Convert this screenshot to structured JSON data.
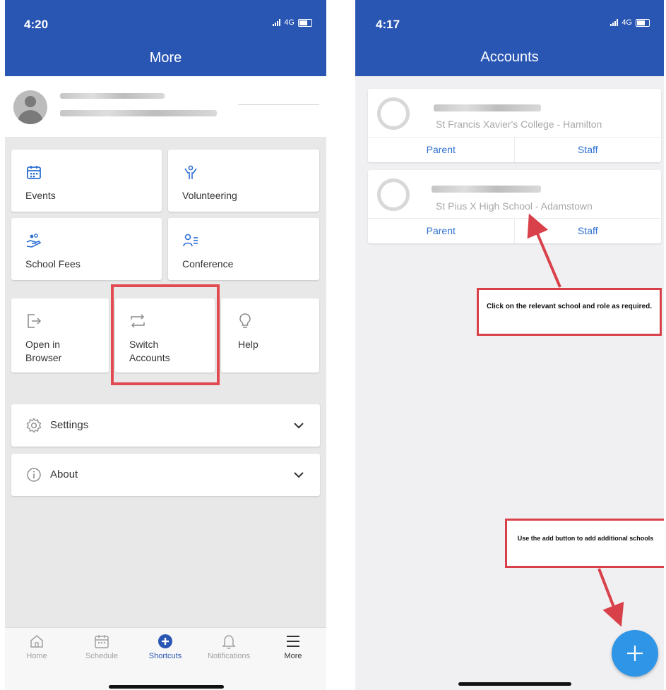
{
  "left_screen": {
    "status_time": "4:20",
    "network": "4G",
    "nav_title": "More",
    "tiles": [
      {
        "label": "Events",
        "icon": "calendar-icon"
      },
      {
        "label": "Volunteering",
        "icon": "volunteer-hands-icon"
      },
      {
        "label": "School Fees",
        "icon": "payment-hand-icon"
      },
      {
        "label": "Conference",
        "icon": "people-list-icon"
      },
      {
        "label": "Open in\nBrowser",
        "icon": "open-external-icon"
      },
      {
        "label": "Switch\nAccounts",
        "icon": "switch-arrows-icon"
      },
      {
        "label": "Help",
        "icon": "lightbulb-icon"
      }
    ],
    "settings_label": "Settings",
    "about_label": "About",
    "tabbar": [
      {
        "label": "Home",
        "icon": "home-icon"
      },
      {
        "label": "Schedule",
        "icon": "schedule-icon"
      },
      {
        "label": "Shortcuts",
        "icon": "shortcuts-plus-icon"
      },
      {
        "label": "Notifications",
        "icon": "bell-icon"
      },
      {
        "label": "More",
        "icon": "hamburger-menu-icon"
      }
    ]
  },
  "right_screen": {
    "status_time": "4:17",
    "network": "4G",
    "nav_title": "Accounts",
    "accounts": [
      {
        "school": "St Francis Xavier's College - Hamilton",
        "role_left": "Parent",
        "role_right": "Staff"
      },
      {
        "school": "St Pius X High School - Adamstown",
        "role_left": "Parent",
        "role_right": "Staff"
      }
    ],
    "callout_roles": "Click on the relevant school and role as required.",
    "callout_add": "Use the add button to add additional schools"
  },
  "colors": {
    "header_blue": "#2a56b3",
    "accent_blue": "#2d6fd2",
    "fab_blue": "#2f95e6",
    "highlight_red": "#e24a51"
  }
}
